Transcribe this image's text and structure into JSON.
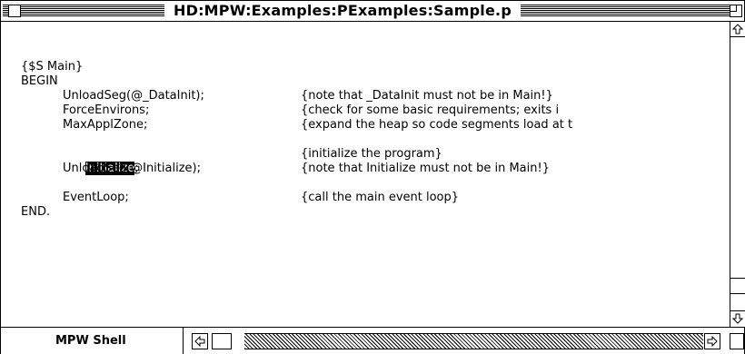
{
  "window": {
    "title": "HD:MPW:Examples:PExamples:Sample.p"
  },
  "editor": {
    "lines": [
      {
        "col1": "{$S Main}",
        "col2": ""
      },
      {
        "col1": "BEGIN",
        "col2": ""
      },
      {
        "col1": "UnloadSeg(@_DataInit);",
        "col2": "{note that _DataInit must not be in Main!}"
      },
      {
        "col1": "ForceEnvirons;",
        "col2": "{check for some basic requirements; exits i"
      },
      {
        "col1": "MaxApplZone;",
        "col2": "{expand the heap so code segments load at t"
      },
      {
        "col1_sel": "Initialize",
        "col1_after": ";",
        "col2": "{initialize the program}"
      },
      {
        "col1": "UnloadSeg(@Initialize);",
        "col2": "{note that Initialize must not be in Main!}"
      },
      {
        "col1": "EventLoop;",
        "col2": "{call the main event loop}"
      },
      {
        "col1": "END.",
        "col2": ""
      }
    ]
  },
  "status": {
    "shell_label": "MPW Shell"
  },
  "icons": {
    "close": "close-box-icon",
    "zoom": "zoom-box-icon",
    "up": "scroll-up-arrow-icon",
    "down": "scroll-down-arrow-icon",
    "left": "scroll-left-arrow-icon",
    "right": "scroll-right-arrow-icon",
    "grow": "size-box-icon"
  },
  "colors": {
    "foreground": "#000000",
    "background": "#ffffff",
    "selection": "#000000"
  }
}
